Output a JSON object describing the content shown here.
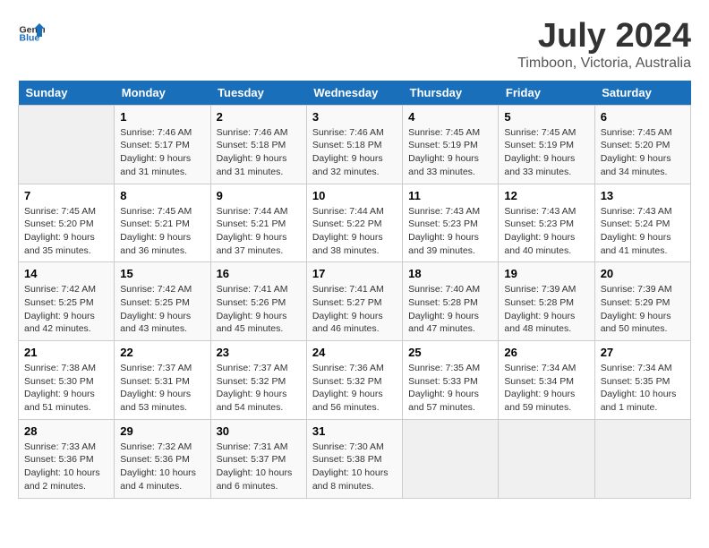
{
  "logo": {
    "text_general": "General",
    "text_blue": "Blue"
  },
  "header": {
    "title": "July 2024",
    "subtitle": "Timboon, Victoria, Australia"
  },
  "weekdays": [
    "Sunday",
    "Monday",
    "Tuesday",
    "Wednesday",
    "Thursday",
    "Friday",
    "Saturday"
  ],
  "days": [
    {
      "date": "",
      "sunrise": "",
      "sunset": "",
      "daylight": ""
    },
    {
      "date": "1",
      "sunrise": "7:46 AM",
      "sunset": "5:17 PM",
      "daylight": "9 hours and 31 minutes."
    },
    {
      "date": "2",
      "sunrise": "7:46 AM",
      "sunset": "5:18 PM",
      "daylight": "9 hours and 31 minutes."
    },
    {
      "date": "3",
      "sunrise": "7:46 AM",
      "sunset": "5:18 PM",
      "daylight": "9 hours and 32 minutes."
    },
    {
      "date": "4",
      "sunrise": "7:45 AM",
      "sunset": "5:19 PM",
      "daylight": "9 hours and 33 minutes."
    },
    {
      "date": "5",
      "sunrise": "7:45 AM",
      "sunset": "5:19 PM",
      "daylight": "9 hours and 33 minutes."
    },
    {
      "date": "6",
      "sunrise": "7:45 AM",
      "sunset": "5:20 PM",
      "daylight": "9 hours and 34 minutes."
    },
    {
      "date": "7",
      "sunrise": "7:45 AM",
      "sunset": "5:20 PM",
      "daylight": "9 hours and 35 minutes."
    },
    {
      "date": "8",
      "sunrise": "7:45 AM",
      "sunset": "5:21 PM",
      "daylight": "9 hours and 36 minutes."
    },
    {
      "date": "9",
      "sunrise": "7:44 AM",
      "sunset": "5:21 PM",
      "daylight": "9 hours and 37 minutes."
    },
    {
      "date": "10",
      "sunrise": "7:44 AM",
      "sunset": "5:22 PM",
      "daylight": "9 hours and 38 minutes."
    },
    {
      "date": "11",
      "sunrise": "7:43 AM",
      "sunset": "5:23 PM",
      "daylight": "9 hours and 39 minutes."
    },
    {
      "date": "12",
      "sunrise": "7:43 AM",
      "sunset": "5:23 PM",
      "daylight": "9 hours and 40 minutes."
    },
    {
      "date": "13",
      "sunrise": "7:43 AM",
      "sunset": "5:24 PM",
      "daylight": "9 hours and 41 minutes."
    },
    {
      "date": "14",
      "sunrise": "7:42 AM",
      "sunset": "5:25 PM",
      "daylight": "9 hours and 42 minutes."
    },
    {
      "date": "15",
      "sunrise": "7:42 AM",
      "sunset": "5:25 PM",
      "daylight": "9 hours and 43 minutes."
    },
    {
      "date": "16",
      "sunrise": "7:41 AM",
      "sunset": "5:26 PM",
      "daylight": "9 hours and 45 minutes."
    },
    {
      "date": "17",
      "sunrise": "7:41 AM",
      "sunset": "5:27 PM",
      "daylight": "9 hours and 46 minutes."
    },
    {
      "date": "18",
      "sunrise": "7:40 AM",
      "sunset": "5:28 PM",
      "daylight": "9 hours and 47 minutes."
    },
    {
      "date": "19",
      "sunrise": "7:39 AM",
      "sunset": "5:28 PM",
      "daylight": "9 hours and 48 minutes."
    },
    {
      "date": "20",
      "sunrise": "7:39 AM",
      "sunset": "5:29 PM",
      "daylight": "9 hours and 50 minutes."
    },
    {
      "date": "21",
      "sunrise": "7:38 AM",
      "sunset": "5:30 PM",
      "daylight": "9 hours and 51 minutes."
    },
    {
      "date": "22",
      "sunrise": "7:37 AM",
      "sunset": "5:31 PM",
      "daylight": "9 hours and 53 minutes."
    },
    {
      "date": "23",
      "sunrise": "7:37 AM",
      "sunset": "5:32 PM",
      "daylight": "9 hours and 54 minutes."
    },
    {
      "date": "24",
      "sunrise": "7:36 AM",
      "sunset": "5:32 PM",
      "daylight": "9 hours and 56 minutes."
    },
    {
      "date": "25",
      "sunrise": "7:35 AM",
      "sunset": "5:33 PM",
      "daylight": "9 hours and 57 minutes."
    },
    {
      "date": "26",
      "sunrise": "7:34 AM",
      "sunset": "5:34 PM",
      "daylight": "9 hours and 59 minutes."
    },
    {
      "date": "27",
      "sunrise": "7:34 AM",
      "sunset": "5:35 PM",
      "daylight": "10 hours and 1 minute."
    },
    {
      "date": "28",
      "sunrise": "7:33 AM",
      "sunset": "5:36 PM",
      "daylight": "10 hours and 2 minutes."
    },
    {
      "date": "29",
      "sunrise": "7:32 AM",
      "sunset": "5:36 PM",
      "daylight": "10 hours and 4 minutes."
    },
    {
      "date": "30",
      "sunrise": "7:31 AM",
      "sunset": "5:37 PM",
      "daylight": "10 hours and 6 minutes."
    },
    {
      "date": "31",
      "sunrise": "7:30 AM",
      "sunset": "5:38 PM",
      "daylight": "10 hours and 8 minutes."
    },
    {
      "date": "",
      "sunrise": "",
      "sunset": "",
      "daylight": ""
    },
    {
      "date": "",
      "sunrise": "",
      "sunset": "",
      "daylight": ""
    },
    {
      "date": "",
      "sunrise": "",
      "sunset": "",
      "daylight": ""
    },
    {
      "date": "",
      "sunrise": "",
      "sunset": "",
      "daylight": ""
    }
  ]
}
